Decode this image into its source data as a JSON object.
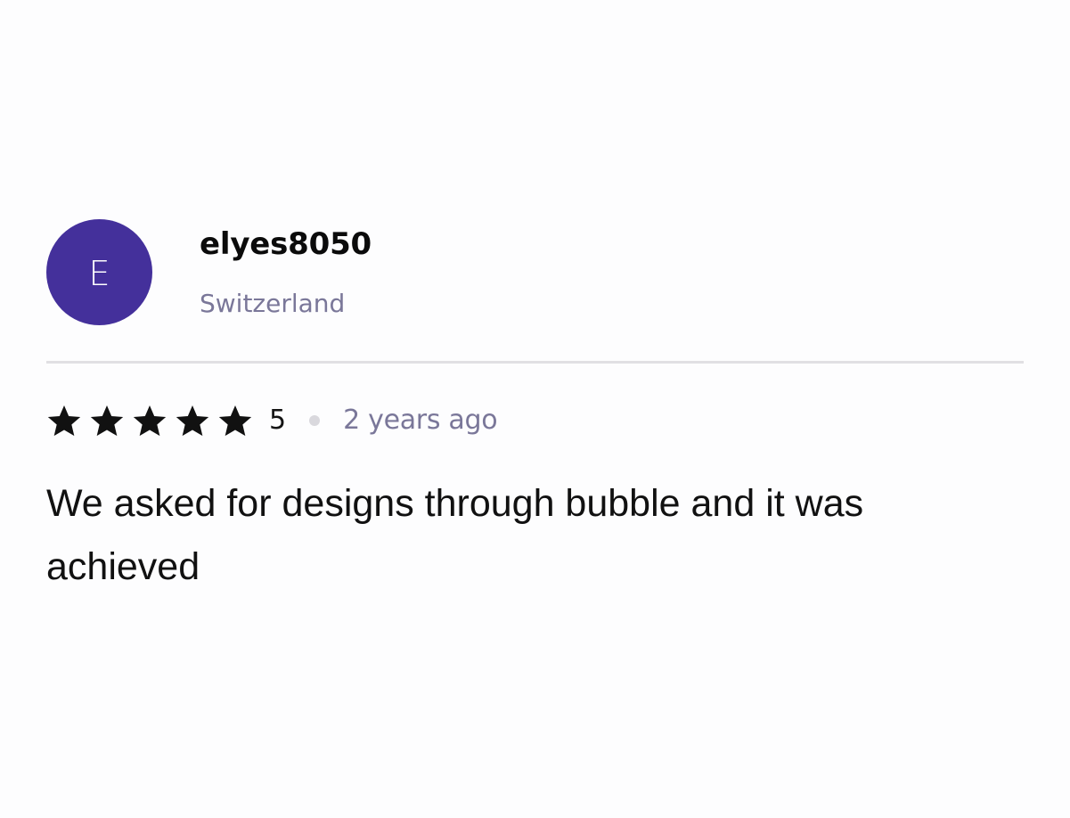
{
  "reviewer": {
    "avatar_letter": "E",
    "avatar_color": "#44309b",
    "name": "elyes8050",
    "country": "Switzerland"
  },
  "rating": {
    "stars": 5,
    "max_stars": 5,
    "star_icon": "star-icon",
    "value_text": "5",
    "time": "2 years ago"
  },
  "review": {
    "text": "We asked for designs through bubble and it was achieved"
  }
}
